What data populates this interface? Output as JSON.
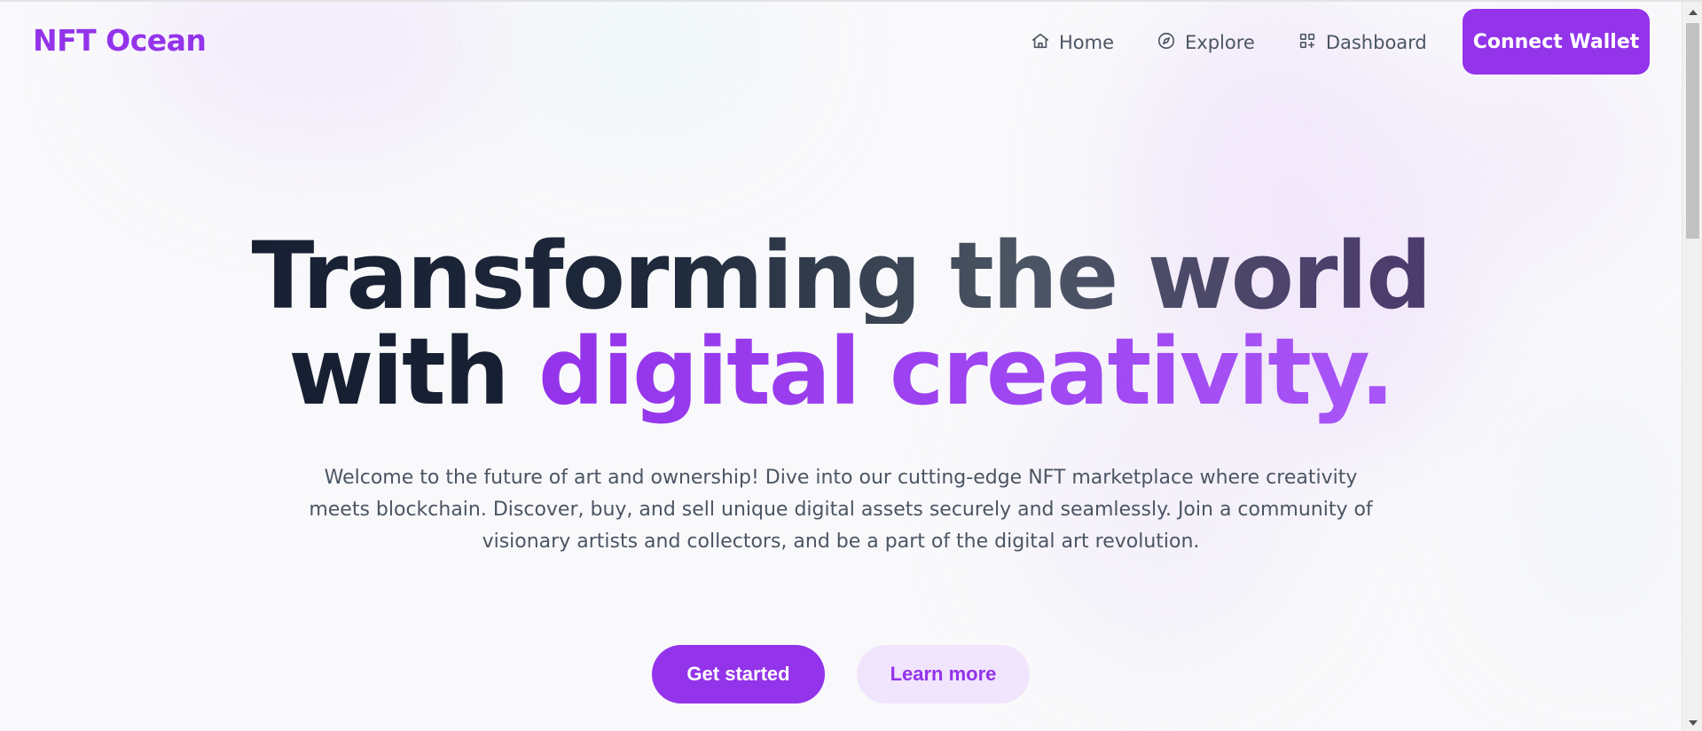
{
  "brand": {
    "name": "NFT Ocean",
    "accent_color": "#9333ea"
  },
  "nav": {
    "items": [
      {
        "label": "Home",
        "icon": "home-icon"
      },
      {
        "label": "Explore",
        "icon": "compass-icon"
      },
      {
        "label": "Dashboard",
        "icon": "dashboard-grid-icon"
      }
    ],
    "connect_wallet_label": "Connect Wallet"
  },
  "hero": {
    "headline_line1": "Transforming the world",
    "headline_line2_plain": "with ",
    "headline_line2_highlight": "digital creativity.",
    "description": "Welcome to the future of art and ownership! Dive into our cutting-edge NFT marketplace where creativity meets blockchain. Discover, buy, and sell unique digital assets securely and seamlessly. Join a community of visionary artists and collectors, and be a part of the digital art revolution.",
    "primary_cta": "Get started",
    "secondary_cta": "Learn more"
  },
  "scrollbar": {
    "up_icon": "scroll-up-arrow-icon",
    "down_icon": "scroll-down-arrow-icon"
  }
}
